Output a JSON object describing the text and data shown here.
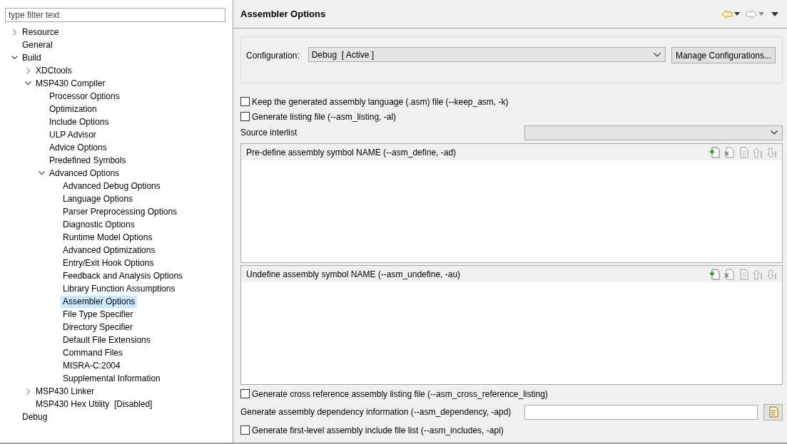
{
  "filter": {
    "placeholder": "type filter text"
  },
  "tree": [
    {
      "label": "Resource",
      "expanded": false,
      "selected": false
    },
    {
      "label": "General",
      "selected": false
    },
    {
      "label": "Build",
      "expanded": true,
      "selected": false,
      "children": [
        {
          "label": "XDCtools",
          "expanded": false,
          "selected": false
        },
        {
          "label": "MSP430 Compiler",
          "expanded": true,
          "selected": false,
          "children": [
            {
              "label": "Processor Options",
              "selected": false
            },
            {
              "label": "Optimization",
              "selected": false
            },
            {
              "label": "Include Options",
              "selected": false
            },
            {
              "label": "ULP Advisor",
              "selected": false
            },
            {
              "label": "Advice Options",
              "selected": false
            },
            {
              "label": "Predefined Symbols",
              "selected": false
            },
            {
              "label": "Advanced Options",
              "expanded": true,
              "selected": false,
              "children": [
                {
                  "label": "Advanced Debug Options",
                  "selected": false
                },
                {
                  "label": "Language Options",
                  "selected": false
                },
                {
                  "label": "Parser Preprocessing Options",
                  "selected": false
                },
                {
                  "label": "Diagnostic Options",
                  "selected": false
                },
                {
                  "label": "Runtime Model Options",
                  "selected": false
                },
                {
                  "label": "Advanced Optimizations",
                  "selected": false
                },
                {
                  "label": "Entry/Exit Hook Options",
                  "selected": false
                },
                {
                  "label": "Feedback and Analysis Options",
                  "selected": false
                },
                {
                  "label": "Library Function Assumptions",
                  "selected": false
                },
                {
                  "label": "Assembler Options",
                  "selected": true
                },
                {
                  "label": "File Type Specifier",
                  "selected": false
                },
                {
                  "label": "Directory Specifier",
                  "selected": false
                },
                {
                  "label": "Default File Extensions",
                  "selected": false
                },
                {
                  "label": "Command Files",
                  "selected": false
                },
                {
                  "label": "MISRA-C:2004",
                  "selected": false
                },
                {
                  "label": "Supplemental Information",
                  "selected": false
                }
              ]
            }
          ]
        },
        {
          "label": "MSP430 Linker",
          "expanded": false,
          "selected": false
        },
        {
          "label": "MSP430 Hex Utility  [Disabled]",
          "selected": false
        }
      ]
    },
    {
      "label": "Debug",
      "selected": false
    }
  ],
  "page": {
    "title": "Assembler Options"
  },
  "configuration": {
    "label": "Configuration:",
    "value": "Debug  [ Active ]",
    "button": "Manage Configurations..."
  },
  "options": [
    {
      "kind": "checkbox",
      "label": "Keep the generated assembly language (.asm) file (--keep_asm, -k)",
      "checked": false
    },
    {
      "kind": "checkbox",
      "label": "Generate listing file (--asm_listing, -al)",
      "checked": false
    },
    {
      "kind": "dropdown",
      "label": "Source interlist"
    },
    {
      "kind": "list",
      "label": "Pre-define assembly symbol NAME (--asm_define, -ad)"
    },
    {
      "kind": "list",
      "label": "Undefine assembly symbol NAME (--asm_undefine, -au)"
    },
    {
      "kind": "checkbox",
      "label": "Generate cross reference assembly listing file (--asm_cross_reference_listing)",
      "checked": false
    },
    {
      "kind": "text",
      "label": "Generate assembly dependency information (--asm_dependency, -apd)"
    },
    {
      "kind": "checkbox",
      "label": "Generate first-level assembly include file list (--asm_includes, -api)",
      "checked": false
    }
  ]
}
